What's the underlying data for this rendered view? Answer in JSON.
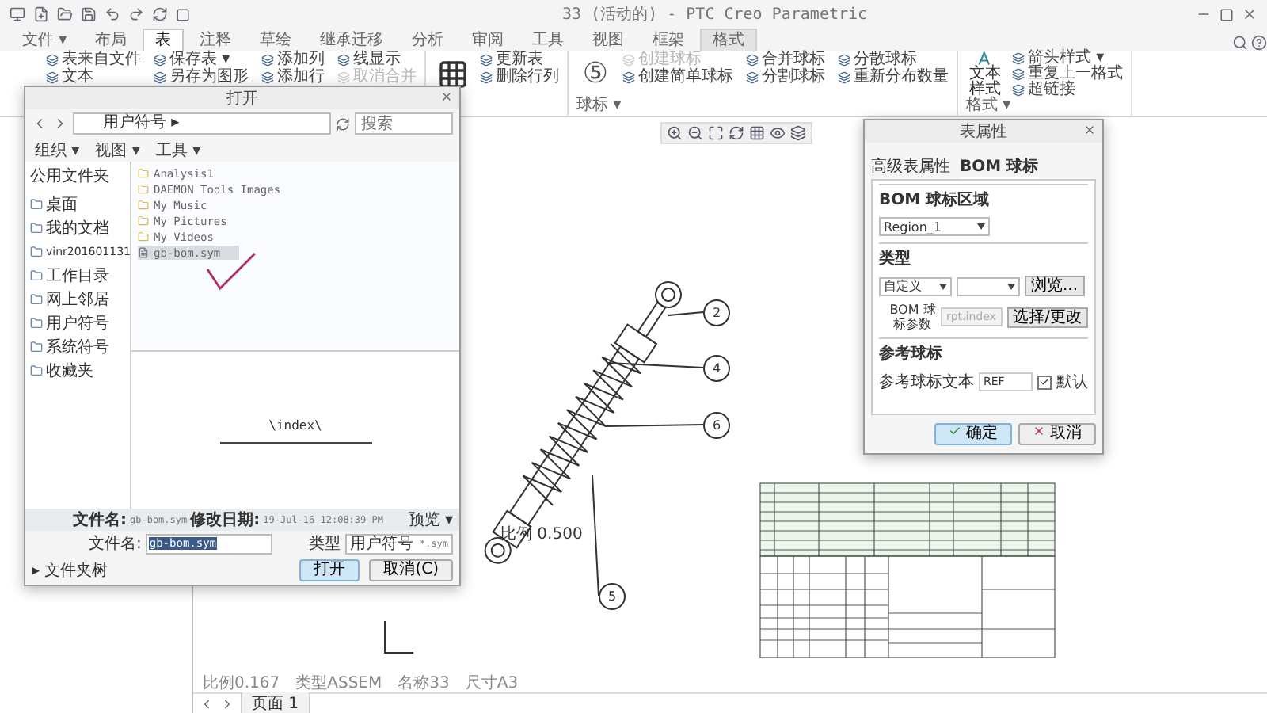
{
  "window": {
    "title": "33 (活动的) - PTC Creo Parametric"
  },
  "ribbon_tabs": [
    {
      "label": "文件 ▾",
      "selected": false,
      "contextual": false
    },
    {
      "label": "布局",
      "selected": false,
      "contextual": false
    },
    {
      "label": "表",
      "selected": true,
      "contextual": false
    },
    {
      "label": "注释",
      "selected": false,
      "contextual": false
    },
    {
      "label": "草绘",
      "selected": false,
      "contextual": false
    },
    {
      "label": "继承迁移",
      "selected": false,
      "contextual": false
    },
    {
      "label": "分析",
      "selected": false,
      "contextual": false
    },
    {
      "label": "审阅",
      "selected": false,
      "contextual": false
    },
    {
      "label": "工具",
      "selected": false,
      "contextual": false
    },
    {
      "label": "视图",
      "selected": false,
      "contextual": false
    },
    {
      "label": "框架",
      "selected": false,
      "contextual": false
    },
    {
      "label": "格式",
      "selected": false,
      "contextual": true
    }
  ],
  "ribbon_groups": [
    {
      "kind": "plain",
      "items": [
        {
          "label": "表来自文件",
          "disabled": false
        },
        {
          "label": "文本",
          "disabled": false
        },
        {
          "label": "保存表 ▾",
          "disabled": false
        },
        {
          "label": "另存为图形",
          "disabled": false
        },
        {
          "label": "添加列",
          "disabled": false
        },
        {
          "label": "添加行",
          "disabled": false
        },
        {
          "label": "线显示",
          "disabled": false
        },
        {
          "label": "取消合并",
          "disabled": true
        }
      ]
    },
    {
      "kind": "grid",
      "items": [
        {
          "label": "更新表",
          "disabled": false
        },
        {
          "label": "删除行列",
          "disabled": false
        }
      ]
    },
    {
      "kind": "balloon",
      "label": "球标 ▾",
      "glyph": "⑤",
      "items": [
        {
          "label": "创建球标",
          "disabled": true
        },
        {
          "label": "创建简单球标",
          "disabled": false
        },
        {
          "label": "合并球标",
          "disabled": false
        },
        {
          "label": "分割球标",
          "disabled": false
        },
        {
          "label": "分散球标",
          "disabled": false
        },
        {
          "label": "重新分布数量",
          "disabled": false
        }
      ]
    },
    {
      "kind": "style",
      "label": "格式 ▾",
      "lead_label": "文本样式",
      "items": [
        {
          "label": "箭头样式 ▾",
          "disabled": false
        },
        {
          "label": "重复上一格式",
          "disabled": false
        },
        {
          "label": "超链接",
          "disabled": false
        }
      ]
    }
  ],
  "drawing": {
    "scale_note": "比例 0.500",
    "balloons": [
      {
        "label": "2"
      },
      {
        "label": "4"
      },
      {
        "label": "6"
      },
      {
        "label": "5"
      }
    ]
  },
  "status_bar": [
    "比例0.167",
    "类型ASSEM",
    "名称33",
    "尺寸A3"
  ],
  "page_tab": "页面 1",
  "open_dialog": {
    "title": "打开",
    "path": "用户符号 ▸",
    "search": {
      "placeholder": "搜索"
    },
    "toolbar": [
      "组织 ▾",
      "视图 ▾",
      "工具 ▾"
    ],
    "sidebar_title": "公用文件夹",
    "places": [
      "桌面",
      "我的文档",
      "vinr201601131",
      "工作目录",
      "网上邻居",
      "用户符号",
      "系统符号",
      "收藏夹"
    ],
    "files": [
      {
        "name": "Analysis1",
        "kind": "folder",
        "selected": false
      },
      {
        "name": "DAEMON Tools Images",
        "kind": "folder",
        "selected": false
      },
      {
        "name": "My Music",
        "kind": "folder",
        "selected": false
      },
      {
        "name": "My Pictures",
        "kind": "folder",
        "selected": false
      },
      {
        "name": "My Videos",
        "kind": "folder",
        "selected": false
      },
      {
        "name": "gb-bom.sym",
        "kind": "file",
        "selected": true
      }
    ],
    "preview_text": "\\index\\",
    "info": {
      "name_label": "文件名:",
      "name": "gb-bom.sym",
      "date_label": "修改日期:",
      "date": "19-Jul-16 12:08:39 PM",
      "preview_toggle": "预览 ▾"
    },
    "filename": {
      "label": "文件名:",
      "value": "gb-bom.sym"
    },
    "type": {
      "label": "类型",
      "value": "用户符号",
      "filter": "*.sym"
    },
    "folder_tree": "▸ 文件夹树",
    "buttons": [
      "打开",
      "取消(C)"
    ]
  },
  "table_dialog": {
    "title": "表属性",
    "tabs": [
      {
        "label": "高级表属性",
        "selected": false
      },
      {
        "label": "BOM 球标",
        "selected": true
      }
    ],
    "region_group": {
      "title": "BOM 球标区域",
      "value": "Region_1"
    },
    "type_group": {
      "title": "类型",
      "value": "自定义",
      "browse": "浏览...",
      "param_label": "BOM 球标参数",
      "param_value": "rpt.index",
      "param_disabled": true,
      "select_button": "选择/更改"
    },
    "ref_group": {
      "title": "参考球标",
      "label": "参考球标文本",
      "value": "REF",
      "default": {
        "label": "默认",
        "checked": true
      }
    },
    "buttons": [
      {
        "label": "确定",
        "kind": "ok"
      },
      {
        "label": "取消",
        "kind": "cancel"
      }
    ]
  }
}
